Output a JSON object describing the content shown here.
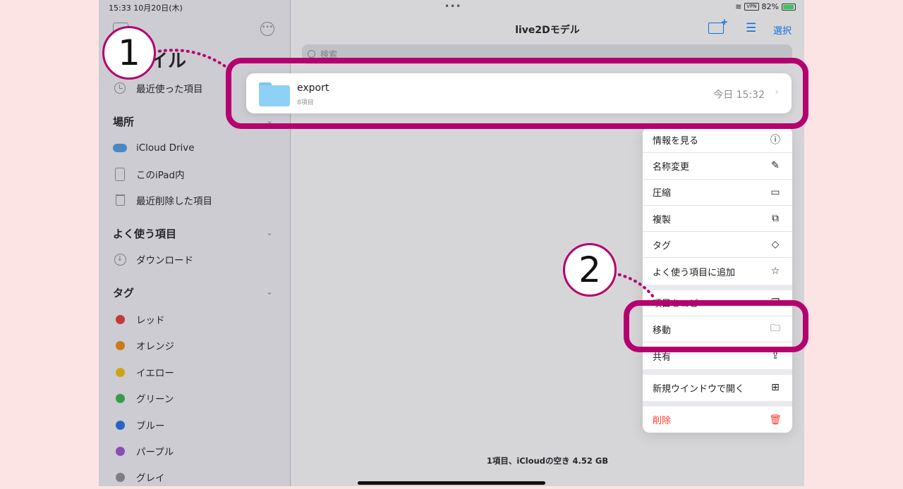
{
  "status": {
    "time": "15:33  10月20日(木)",
    "dots": "•••",
    "vpn": "VPN",
    "battery": "82%"
  },
  "sidebar": {
    "title": "ファイル",
    "recent": "最近使った項目",
    "locations_header": "場所",
    "locations": [
      "iCloud Drive",
      "このiPad内",
      "最近削除した項目"
    ],
    "favorites_header": "よく使う項目",
    "favorites": [
      "ダウンロード"
    ],
    "tags_header": "タグ",
    "tags": [
      {
        "label": "レッド",
        "color": "#e53935"
      },
      {
        "label": "オレンジ",
        "color": "#f0890c"
      },
      {
        "label": "イエロー",
        "color": "#f2c200"
      },
      {
        "label": "グリーン",
        "color": "#34b44a"
      },
      {
        "label": "ブルー",
        "color": "#1e6fe0"
      },
      {
        "label": "パープル",
        "color": "#a14fd4"
      },
      {
        "label": "グレイ",
        "color": "#8e8e93"
      }
    ]
  },
  "main": {
    "title": "live2Dモデル",
    "select": "選択",
    "search_placeholder": "検索",
    "footer": "1項目、iCloudの空き 4.52 GB"
  },
  "item": {
    "name": "export",
    "count": "8項目",
    "date": "今日 15:32"
  },
  "menu": [
    {
      "label": "情報を見る",
      "icon": "info-icon",
      "glyph": "ⓘ"
    },
    {
      "label": "名称変更",
      "icon": "pencil-icon",
      "glyph": "✎"
    },
    {
      "label": "圧縮",
      "icon": "archive-box-icon",
      "glyph": "▭"
    },
    {
      "label": "複製",
      "icon": "duplicate-icon",
      "glyph": "⧉"
    },
    {
      "label": "タグ",
      "icon": "tag-icon",
      "glyph": "◇"
    },
    {
      "label": "よく使う項目に追加",
      "icon": "star-icon",
      "glyph": "☆"
    },
    {
      "label": "項目をコピー",
      "icon": "copy-icon",
      "glyph": "❐"
    },
    {
      "label": "移動",
      "icon": "folder-icon",
      "glyph": "🗀"
    },
    {
      "label": "共有",
      "icon": "share-icon",
      "glyph": "⇪"
    },
    {
      "label": "新規ウインドウで開く",
      "icon": "grid-icon",
      "glyph": "⊞"
    },
    {
      "label": "削除",
      "icon": "trash-icon",
      "glyph": "🗑"
    }
  ],
  "annotations": {
    "step1": "1",
    "step2": "2",
    "color": "#b5006f"
  }
}
